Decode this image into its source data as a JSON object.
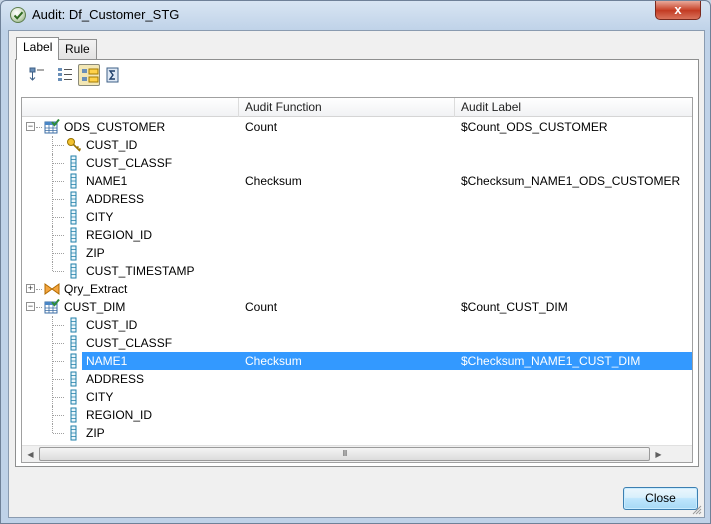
{
  "window": {
    "title": "Audit: Df_Customer_STG",
    "close_glyph": "x"
  },
  "tabs": [
    {
      "label": "Label",
      "active": true
    },
    {
      "label": "Rule",
      "active": false
    }
  ],
  "toolbar": {
    "buttons": [
      {
        "icon": "collapse-tree-icon"
      },
      {
        "icon": "expand-all-icon"
      },
      {
        "icon": "show-labeled-only-icon",
        "pressed": true
      },
      {
        "icon": "sigma-function-icon"
      }
    ]
  },
  "grid": {
    "columns": [
      "",
      "Audit Function",
      "Audit Label"
    ],
    "rows": [
      {
        "level": 0,
        "type": "table",
        "expander": "−",
        "name": "ODS_CUSTOMER",
        "function": "Count",
        "label": "$Count_ODS_CUSTOMER"
      },
      {
        "level": 1,
        "type": "key",
        "name": "CUST_ID",
        "function": "",
        "label": ""
      },
      {
        "level": 1,
        "type": "column",
        "name": "CUST_CLASSF",
        "function": "",
        "label": ""
      },
      {
        "level": 1,
        "type": "column",
        "name": "NAME1",
        "function": "Checksum",
        "label": "$Checksum_NAME1_ODS_CUSTOMER"
      },
      {
        "level": 1,
        "type": "column",
        "name": "ADDRESS",
        "function": "",
        "label": ""
      },
      {
        "level": 1,
        "type": "column",
        "name": "CITY",
        "function": "",
        "label": ""
      },
      {
        "level": 1,
        "type": "column",
        "name": "REGION_ID",
        "function": "",
        "label": ""
      },
      {
        "level": 1,
        "type": "column",
        "name": "ZIP",
        "function": "",
        "label": ""
      },
      {
        "level": 1,
        "type": "column",
        "name": "CUST_TIMESTAMP",
        "function": "",
        "label": ""
      },
      {
        "level": 0,
        "type": "query",
        "expander": "+",
        "name": "Qry_Extract",
        "function": "",
        "label": ""
      },
      {
        "level": 0,
        "type": "table",
        "expander": "−",
        "name": "CUST_DIM",
        "function": "Count",
        "label": "$Count_CUST_DIM"
      },
      {
        "level": 1,
        "type": "column",
        "name": "CUST_ID",
        "function": "",
        "label": ""
      },
      {
        "level": 1,
        "type": "column",
        "name": "CUST_CLASSF",
        "function": "",
        "label": ""
      },
      {
        "level": 1,
        "type": "column",
        "name": "NAME1",
        "function": "Checksum",
        "label": "$Checksum_NAME1_CUST_DIM",
        "selected": true
      },
      {
        "level": 1,
        "type": "column",
        "name": "ADDRESS",
        "function": "",
        "label": ""
      },
      {
        "level": 1,
        "type": "column",
        "name": "CITY",
        "function": "",
        "label": ""
      },
      {
        "level": 1,
        "type": "column",
        "name": "REGION_ID",
        "function": "",
        "label": ""
      },
      {
        "level": 1,
        "type": "column",
        "name": "ZIP",
        "function": "",
        "label": ""
      }
    ]
  },
  "scrollbar": {
    "grip": "III"
  },
  "buttons": {
    "close_label": "Close"
  },
  "colors": {
    "selection": "#3399ff",
    "table_icon": "#2e8b3a",
    "column_icon": "#1f7fa8"
  }
}
